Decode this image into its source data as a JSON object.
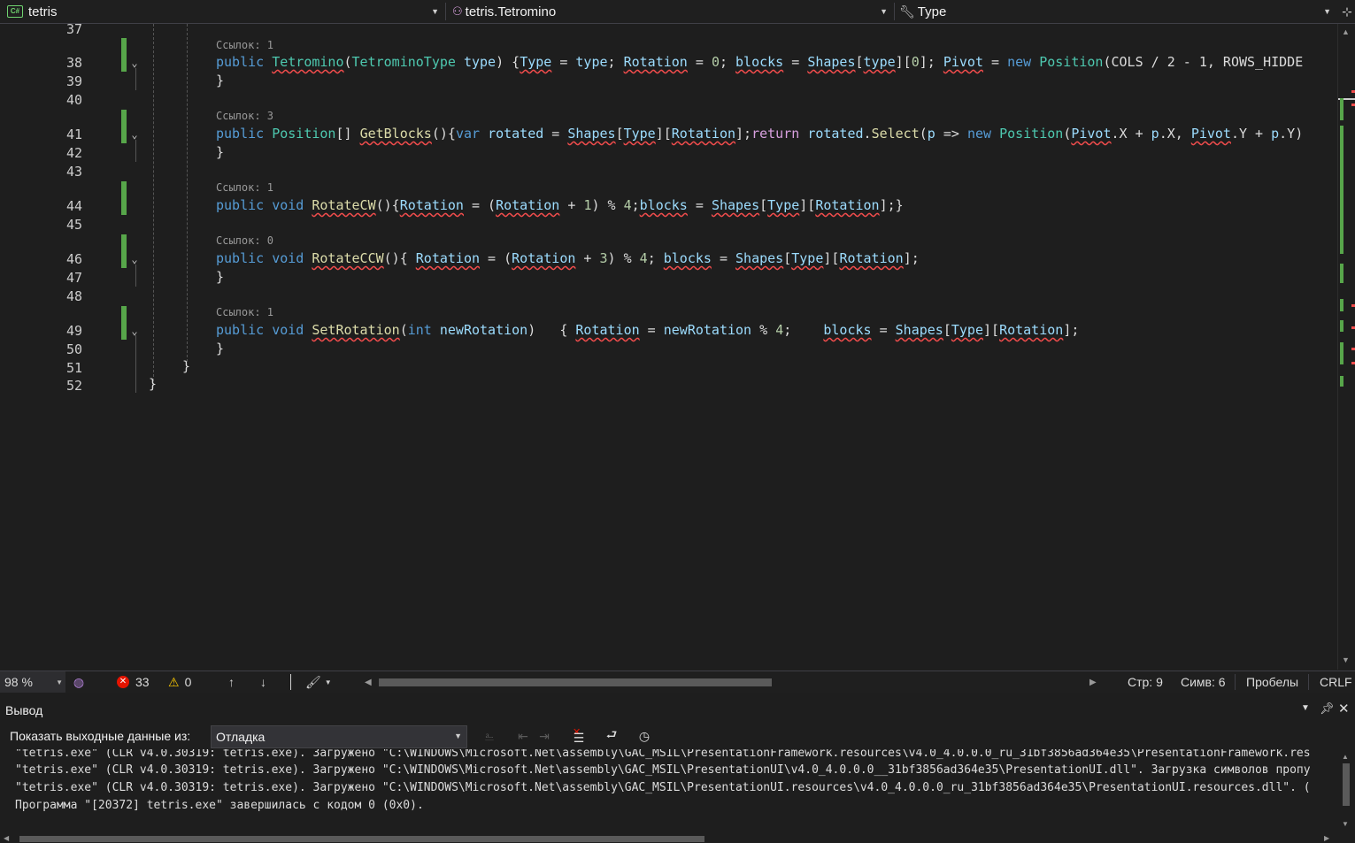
{
  "navbar": {
    "project": "tetris",
    "type": "tetris.Tetromino",
    "member": "Type",
    "project_icon": "csharp-project-icon",
    "type_icon": "class-icon",
    "member_icon": "wrench-property-icon"
  },
  "editor": {
    "line_numbers": [
      "37",
      "38",
      "39",
      "40",
      "41",
      "42",
      "43",
      "44",
      "45",
      "46",
      "47",
      "48",
      "49",
      "50",
      "51",
      "52"
    ],
    "codelens": [
      "Ссылок: 1",
      "Ссылок: 3",
      "Ссылок: 1",
      "Ссылок: 0",
      "Ссылок: 1"
    ],
    "lines": {
      "l38": [
        "public",
        " ",
        "Tetromino",
        "(",
        "TetrominoType",
        " ",
        "type",
        ") {",
        "Type",
        " = ",
        "type",
        "; ",
        "Rotation",
        " = ",
        "0",
        "; ",
        "blocks",
        " = ",
        "Shapes",
        "[",
        "type",
        "][",
        "0",
        "]; ",
        "Pivot",
        " = ",
        "new",
        " ",
        "Position",
        "(COLS / 2 - 1, ROWS_HIDDE"
      ],
      "l39": "}",
      "l41": [
        "public",
        " ",
        "Position",
        "[] ",
        "GetBlocks",
        "(){",
        "var",
        " ",
        "rotated",
        " = ",
        "Shapes",
        "[",
        "Type",
        "][",
        "Rotation",
        "];",
        "return",
        " ",
        "rotated",
        ".",
        "Select",
        "(",
        "p",
        " => ",
        "new",
        " ",
        "Position",
        "(",
        "Pivot",
        ".X + ",
        "p",
        ".X, ",
        "Pivot",
        ".Y + ",
        "p",
        ".Y)"
      ],
      "l42": "}",
      "l44": [
        "public",
        " ",
        "void",
        " ",
        "RotateCW",
        "(){",
        "Rotation",
        " = (",
        "Rotation",
        " + ",
        "1",
        ") % ",
        "4",
        ";",
        "blocks",
        " = ",
        "Shapes",
        "[",
        "Type",
        "][",
        "Rotation",
        "];}"
      ],
      "l46": [
        "public",
        " ",
        "void",
        " ",
        "RotateCCW",
        "(){ ",
        "Rotation",
        " = (",
        "Rotation",
        " + ",
        "3",
        ") % ",
        "4",
        "; ",
        "blocks",
        " = ",
        "Shapes",
        "[",
        "Type",
        "][",
        "Rotation",
        "];"
      ],
      "l47": "}",
      "l49": [
        "public",
        " ",
        "void",
        " ",
        "SetRotation",
        "(",
        "int",
        " ",
        "newRotation",
        ")   { ",
        "Rotation",
        " = ",
        "newRotation",
        " % ",
        "4",
        ";    ",
        "blocks",
        " = ",
        "Shapes",
        "[",
        "Type",
        "][",
        "Rotation",
        "];"
      ],
      "l50": "}",
      "l51": "}",
      "l52": "}"
    }
  },
  "status": {
    "zoom": "98 %",
    "errors": "33",
    "warnings": "0",
    "line": "Стр: 9",
    "col": "Симв: 6",
    "indent": "Пробелы",
    "eol": "CRLF"
  },
  "output": {
    "title": "Вывод",
    "source_label": "Показать выходные данные из:",
    "source_value": "Отладка",
    "lines": [
      "\"tetris.exe\" (CLR v4.0.30319: tetris.exe). Загружено \"C:\\WINDOWS\\Microsoft.Net\\assembly\\GAC_MSIL\\PresentationFramework.resources\\v4.0_4.0.0.0_ru_31bf3856ad364e35\\PresentationFramework.res",
      "\"tetris.exe\" (CLR v4.0.30319: tetris.exe). Загружено \"C:\\WINDOWS\\Microsoft.Net\\assembly\\GAC_MSIL\\PresentationUI\\v4.0_4.0.0.0__31bf3856ad364e35\\PresentationUI.dll\". Загрузка символов пропу",
      "\"tetris.exe\" (CLR v4.0.30319: tetris.exe). Загружено \"C:\\WINDOWS\\Microsoft.Net\\assembly\\GAC_MSIL\\PresentationUI.resources\\v4.0_4.0.0.0_ru_31bf3856ad364e35\\PresentationUI.resources.dll\". (",
      "Программа \"[20372] tetris.exe\" завершилась с кодом 0 (0x0)."
    ]
  }
}
